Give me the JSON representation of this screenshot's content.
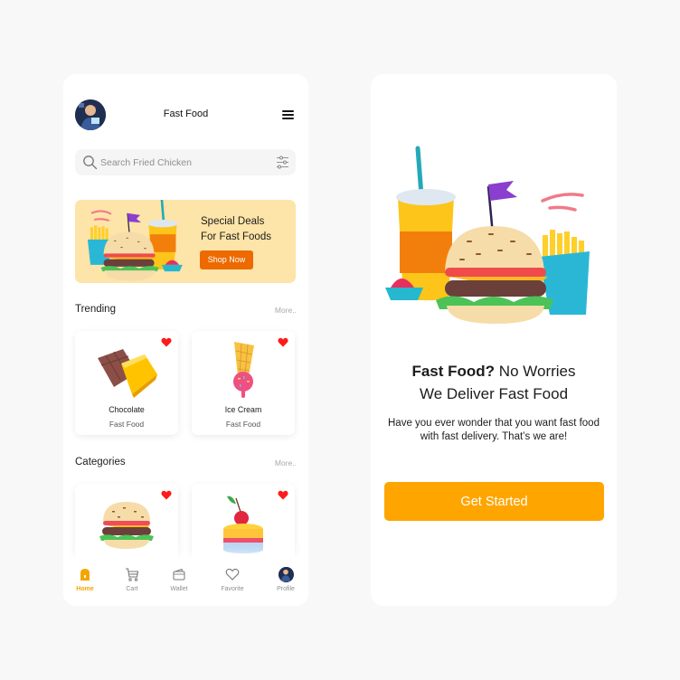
{
  "home_screen": {
    "header": {
      "avatar": "user-avatar",
      "title": "Fast Food",
      "menu_icon": "hamburger-menu-icon"
    },
    "search": {
      "placeholder": "Search Fried Chicken",
      "value": "",
      "icon": "search-icon",
      "filter_icon": "sliders-icon"
    },
    "promo": {
      "title_line1": "Special Deals",
      "title_line2": "For Fast Foods",
      "button_label": "Shop Now",
      "illustration": "fast-food-combo-illustration"
    },
    "trending": {
      "title": "Trending",
      "more_label": "More..",
      "items": [
        {
          "name": "Chocolate",
          "category": "Fast Food",
          "favorite": true,
          "image": "chocolate-bar"
        },
        {
          "name": "Ice Cream",
          "category": "Fast Food",
          "favorite": true,
          "image": "ice-cream-cone"
        }
      ]
    },
    "categories": {
      "title": "Categories",
      "more_label": "More..",
      "items": [
        {
          "favorite": true,
          "image": "burger"
        },
        {
          "favorite": true,
          "image": "cherry-cake"
        }
      ]
    },
    "bottom_nav": {
      "active": "Home",
      "items": [
        {
          "label": "Home",
          "icon": "home-icon"
        },
        {
          "label": "Cart",
          "icon": "cart-icon"
        },
        {
          "label": "Wallet",
          "icon": "wallet-icon"
        },
        {
          "label": "Favorite",
          "icon": "heart-icon"
        },
        {
          "label": "Profile",
          "icon": "avatar"
        }
      ]
    }
  },
  "onboarding_screen": {
    "illustration": "fast-food-combo-illustration",
    "title_bold": "Fast Food?",
    "title_rest": " No Worries",
    "title_line2": "We Deliver Fast Food",
    "description": "Have you ever wonder that you want fast food with fast delivery. That’s we are!",
    "button_label": "Get Started"
  },
  "colors": {
    "background": "#f8f8f8",
    "panel": "#ffffff",
    "promo_bg": "#fde4a8",
    "promo_button": "#ec6a00",
    "accent": "#fea500",
    "heart": "#ff1a1a",
    "muted_text": "#a8a8a8"
  }
}
